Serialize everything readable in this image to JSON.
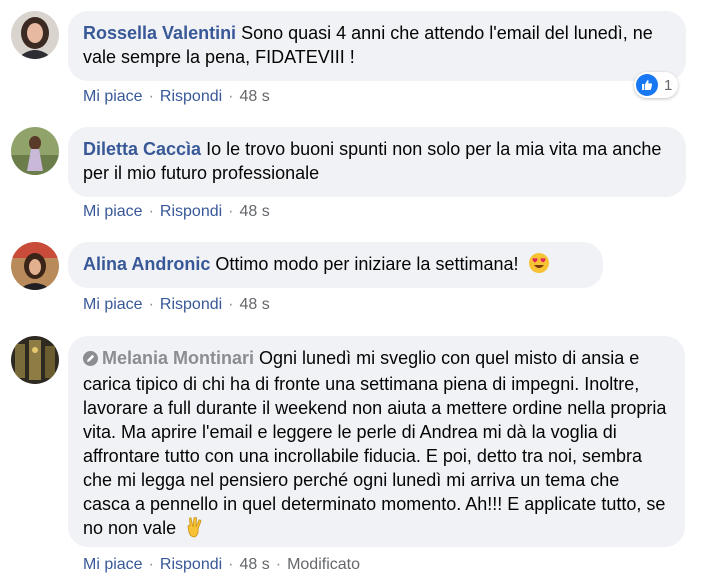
{
  "actions": {
    "like": "Mi piace",
    "reply": "Rispondi",
    "separator": "·"
  },
  "comments": [
    {
      "author": "Rossella Valentini",
      "text": "Sono quasi 4 anni che attendo l'email del lunedì, ne vale sempre la pena, FIDATEVIII !",
      "time": "48 s",
      "reactions": {
        "icon": "like-icon",
        "count": "1"
      }
    },
    {
      "author": "Diletta Caccìa",
      "text": "Io le trovo buoni spunti non solo per la mia vita ma anche per il mio futuro professionale",
      "time": "48 s"
    },
    {
      "author": "Alina Andronic",
      "text": "Ottimo modo per iniziare la settimana!",
      "emoji": "heart-eyes-emoji",
      "time": "48 s"
    },
    {
      "author": "Melania Montinari",
      "author_icon": "edited-pencil-icon",
      "text": "Ogni lunedì mi sveglio con quel misto di ansia e carica tipico di chi ha di fronte una settimana piena di impegni. Inoltre, lavorare a full durante il weekend non aiuta a mettere ordine nella propria vita. Ma aprire l'email e leggere le perle di Andrea mi dà la voglia di affrontare tutto con una incrollabile fiducia. E poi, detto tra noi, sembra che mi legga nel pensiero perché ogni lunedì mi arriva un tema che casca a pennello in quel determinato momento. Ah!!! E applicate tutto, se no non vale",
      "emoji": "victory-hand-emoji",
      "time": "48 s",
      "edited": "Modificato"
    }
  ],
  "colors": {
    "bubble": "#f0f2f5",
    "author": "#385898",
    "meta": "#65676b",
    "like_badge": "#1877f2"
  }
}
